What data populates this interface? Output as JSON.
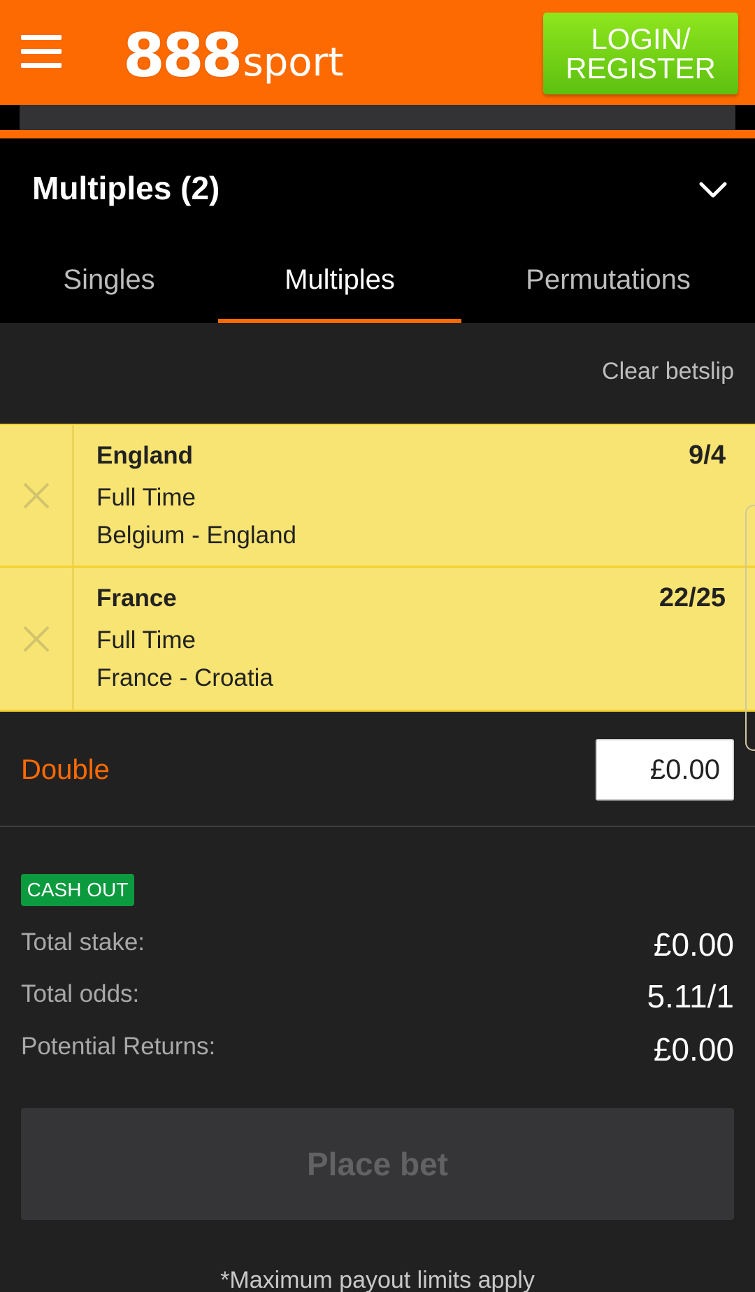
{
  "header": {
    "logo_number": "888",
    "logo_word": "sport",
    "login_label": "LOGIN/ REGISTER",
    "brand_color": "#fd6a02",
    "login_color": "#7ad616"
  },
  "betslip": {
    "title": "Multiples (2)",
    "tabs": [
      {
        "label": "Singles",
        "active": false
      },
      {
        "label": "Multiples",
        "active": true
      },
      {
        "label": "Permutations",
        "active": false
      }
    ],
    "clear_label": "Clear betslip",
    "selections": [
      {
        "name": "England",
        "odds": "9/4",
        "market": "Full Time",
        "event": "Belgium - England"
      },
      {
        "name": "France",
        "odds": "22/25",
        "market": "Full Time",
        "event": "France - Croatia"
      }
    ],
    "bet_type": "Double",
    "stake_value": "£0.00",
    "cashout_label": "CASH OUT",
    "summary": {
      "stake_label": "Total stake:",
      "stake_value": "£0.00",
      "odds_label": "Total odds:",
      "odds_value": "5.11/1",
      "returns_label": "Potential Returns:",
      "returns_value": "£0.00"
    },
    "place_bet_label": "Place bet",
    "payout_note": "*Maximum payout limits apply"
  },
  "icons": {
    "menu": "hamburger-menu-icon",
    "collapse": "chevron-down-icon",
    "remove": "close-icon"
  }
}
